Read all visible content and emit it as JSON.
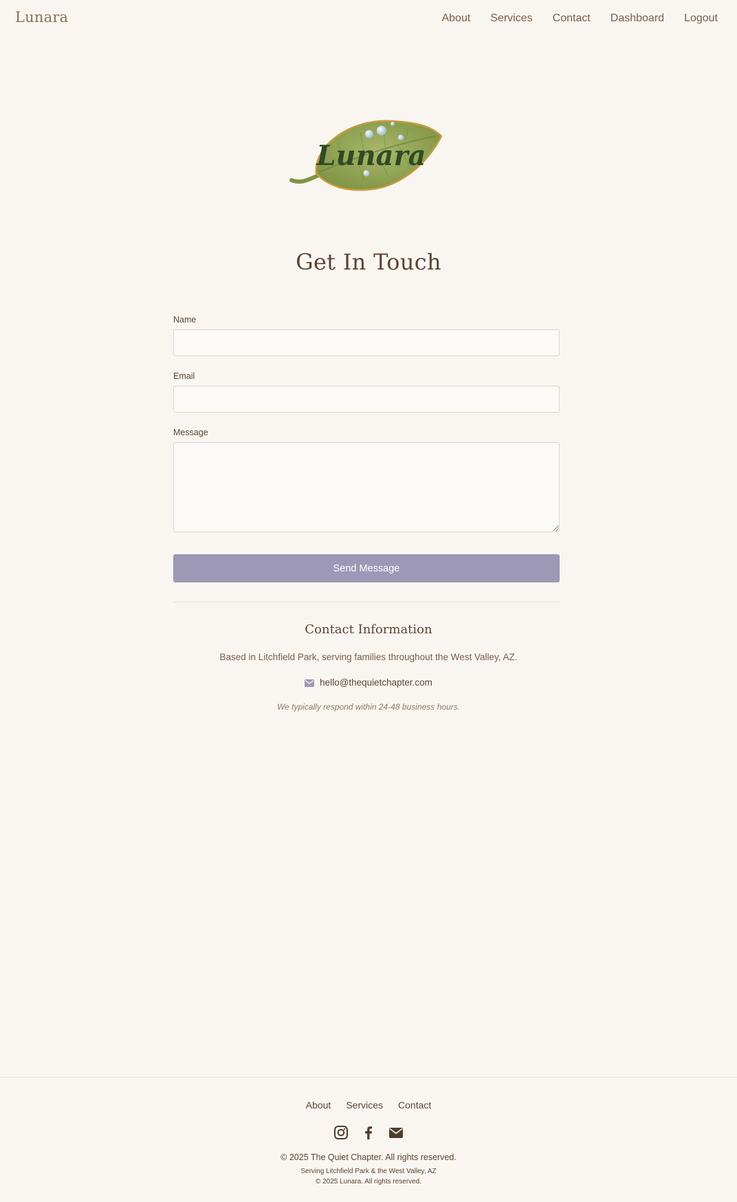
{
  "header": {
    "brand": "Lunara",
    "nav": [
      "About",
      "Services",
      "Contact",
      "Dashboard",
      "Logout"
    ]
  },
  "logo": {
    "text": "Lunara",
    "icon": "leaf-logo"
  },
  "page": {
    "title": "Get In Touch"
  },
  "form": {
    "name_label": "Name",
    "name_value": "",
    "email_label": "Email",
    "email_value": "",
    "message_label": "Message",
    "message_value": "",
    "submit_label": "Send Message"
  },
  "contact_info": {
    "title": "Contact Information",
    "base": "Based in Litchfield Park, serving families throughout the West Valley, AZ.",
    "email": "hello@thequietchapter.com",
    "note": "We typically respond within 24-48 business hours."
  },
  "footer": {
    "links": [
      "About",
      "Services",
      "Contact"
    ],
    "social_icons": [
      "instagram-icon",
      "facebook-icon",
      "email-icon"
    ],
    "copyright": "© 2025 The Quiet Chapter. All rights reserved.",
    "serving": "Serving Litchfield Park & the West Valley, AZ",
    "copyright2": "© 2025 Lunara. All rights reserved."
  },
  "colors": {
    "background": "#f9f6f1",
    "accent_button": "#9d98b5",
    "text_brown": "#5a4433",
    "leaf_green": "#8aa04e"
  }
}
